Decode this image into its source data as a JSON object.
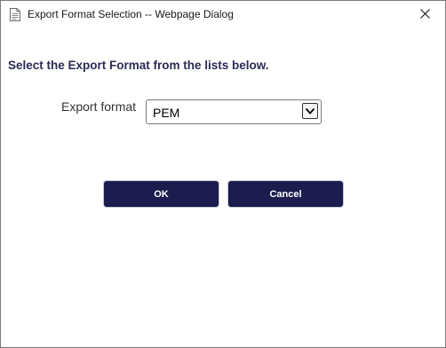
{
  "window": {
    "title": "Export Format Selection -- Webpage Dialog",
    "title_icon": "document-icon",
    "close_icon": "close-icon"
  },
  "form": {
    "heading": "Select the Export Format from the lists below.",
    "export_format_label": "Export format",
    "export_format_value": "PEM",
    "dropdown_icon": "chevron-down-icon"
  },
  "buttons": {
    "ok_label": "OK",
    "cancel_label": "Cancel"
  },
  "colors": {
    "heading": "#2b2b55",
    "button_bg": "#1c1c4e",
    "button_text": "#ffffff"
  }
}
